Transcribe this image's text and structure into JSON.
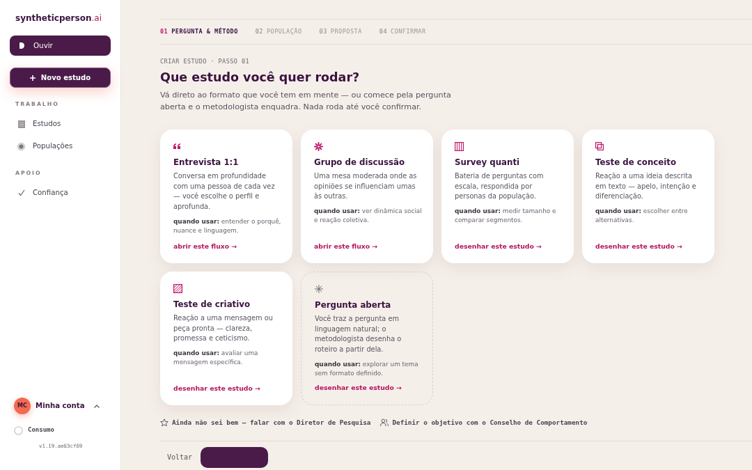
{
  "sidebar": {
    "logo": {
      "name": "syntheticperson",
      "suffix": ".ai"
    },
    "listen_button": {
      "label": "Ouvir"
    },
    "new_study_button": {
      "label": "Novo estudo"
    },
    "sections": [
      {
        "title": "TRABALHO",
        "items": [
          {
            "label": "Estudos"
          },
          {
            "label": "Populações"
          }
        ]
      },
      {
        "title": "APOIO",
        "items": [
          {
            "label": "Confiança"
          }
        ]
      }
    ],
    "account": {
      "initials": "MC",
      "label": "Minha conta",
      "expanded": true
    },
    "usage": {
      "label": "Consumo"
    },
    "version": "v1.19.ae83cf69"
  },
  "stepper": [
    {
      "number": "01",
      "label": "PERGUNTA & MÉTODO",
      "selected": true
    },
    {
      "number": "02",
      "label": "POPULAÇÃO",
      "selected": false
    },
    {
      "number": "03",
      "label": "PROPOSTA",
      "selected": false
    },
    {
      "number": "04",
      "label": "CONFIRMAR",
      "selected": false
    }
  ],
  "header": {
    "eyebrow": "CRIAR ESTUDO · PASSO 01",
    "title": "Que estudo você quer rodar?",
    "intro": "Vá direto ao formato que você tem em mente — ou comece pela pergunta aberta e o metodologista enquadra. Nada roda até você confirmar."
  },
  "cards": [
    {
      "kind": "format",
      "title": "Entrevista 1:1",
      "description": "Conversa em profundidade com uma pessoa de cada vez — você escolhe o perfil e aprofunda.",
      "usage": "**quando usar:** entender o porquê, nuance e linguagem.",
      "link": "abrir este fluxo →"
    },
    {
      "kind": "format",
      "title": "Grupo de discussão",
      "description": "Uma mesa moderada onde as opiniões se influenciam umas às outras.",
      "usage": "**quando usar:** ver dinâmica social e reação coletiva.",
      "link": "abrir este fluxo →"
    },
    {
      "kind": "format",
      "title": "Survey quanti",
      "description": "Bateria de perguntas com escala, respondida por personas da população.",
      "usage": "**quando usar:** medir tamanho e comparar segmentos.",
      "link": "desenhar este estudo →"
    },
    {
      "kind": "format",
      "title": "Teste de conceito",
      "description": "Reação a uma ideia descrita em texto — apelo, intenção e diferenciação.",
      "usage": "**quando usar:** escolher entre alternativas.",
      "link": "desenhar este estudo →"
    },
    {
      "kind": "format",
      "title": "Teste de criativo",
      "description": "Reação a uma mensagem ou peça pronta — clareza, promessa e ceticismo.",
      "usage": "**quando usar:** avaliar uma mensagem específica.",
      "link": "desenhar este estudo →"
    },
    {
      "kind": "open",
      "title": "Pergunta aberta",
      "description": "Você traz a pergunta em linguagem natural; o metodologista desenha o roteiro a partir dela.",
      "usage": "**quando usar:** explorar um tema sem formato definido.",
      "link": "desenhar este estudo →"
    }
  ],
  "help_links": [
    {
      "label": "Ainda não sei bem — falar com o Diretor de Pesquisa"
    },
    {
      "label": "Definir o objetivo com o Conselho de Comportamento"
    }
  ],
  "footer": {
    "back_button": "Voltar"
  }
}
